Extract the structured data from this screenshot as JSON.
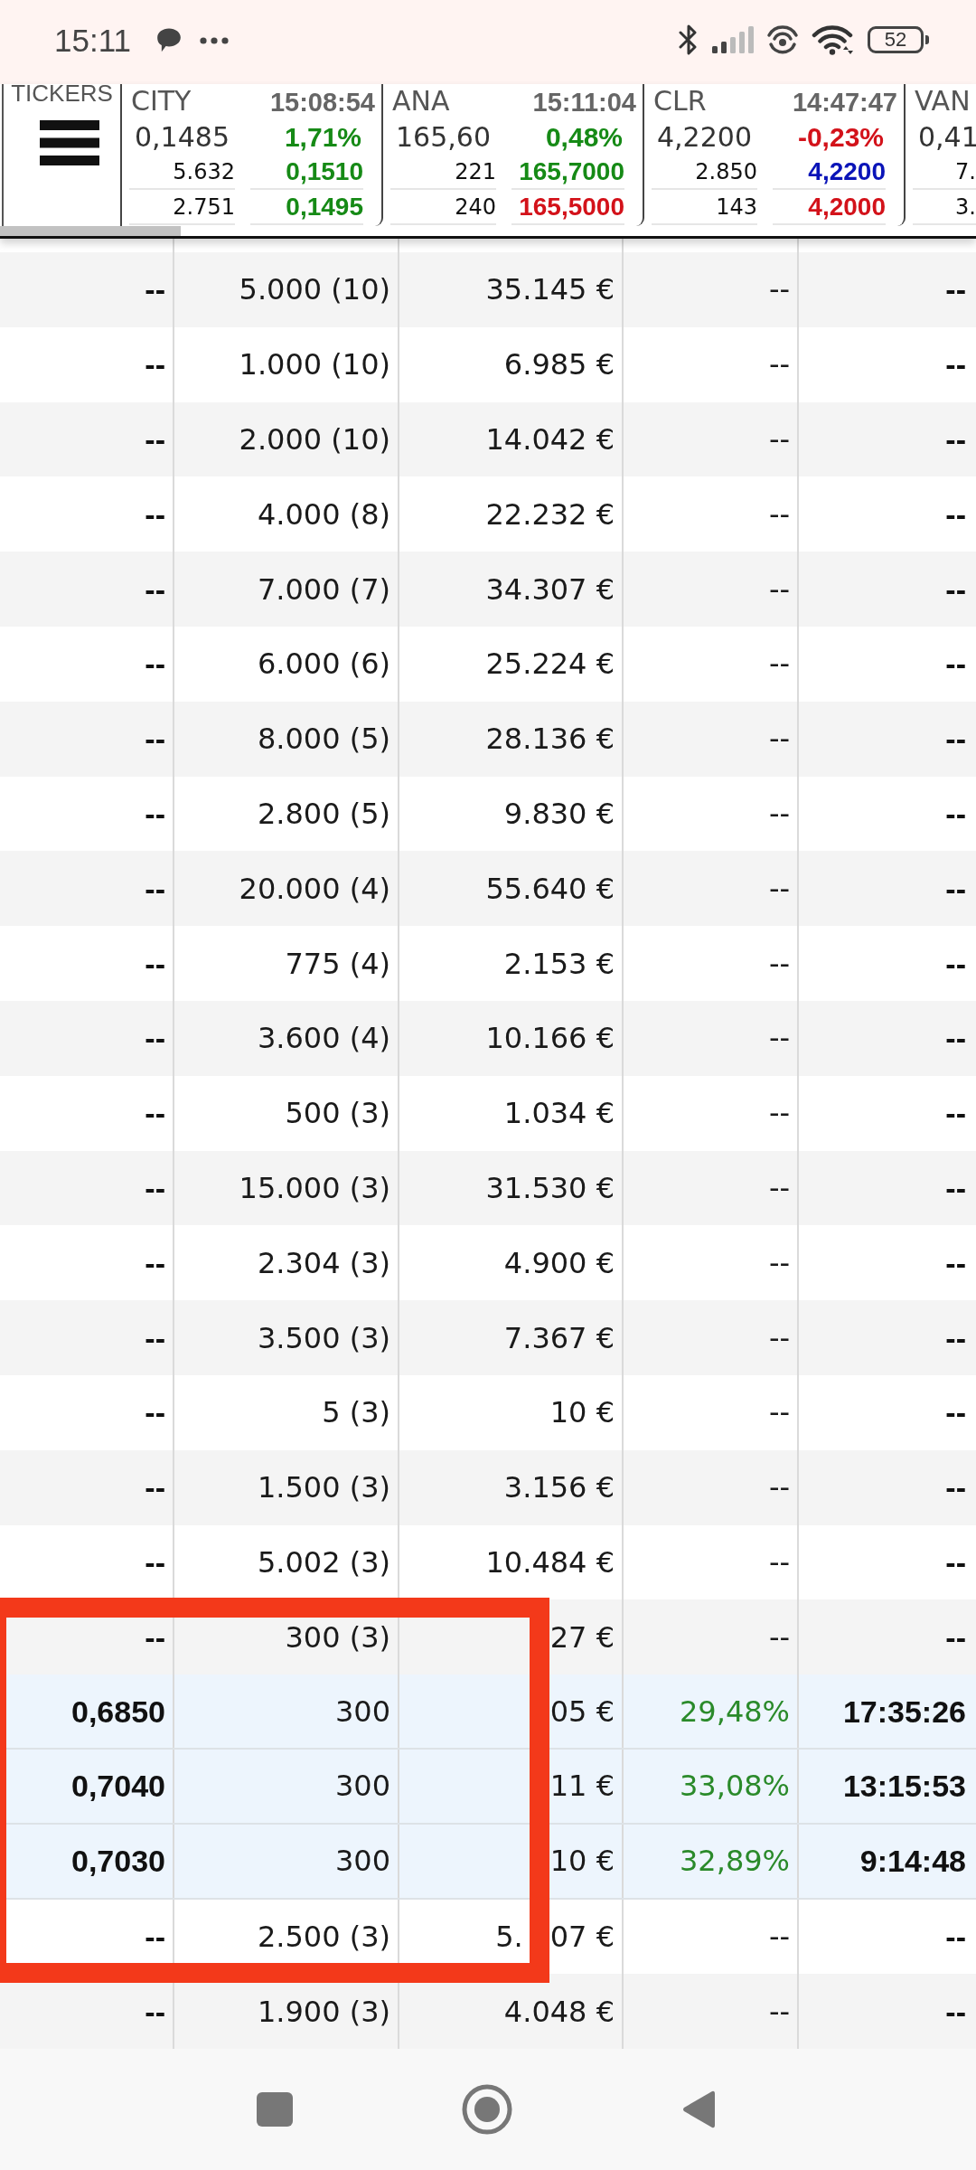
{
  "status_bar": {
    "time": "15:11",
    "battery": "52"
  },
  "tickers": {
    "label": "TICKERS",
    "items": [
      {
        "symbol": "CITY",
        "time": "15:08:54",
        "price": "0,1485",
        "change": {
          "text": "1,71%",
          "color": "#168a16"
        },
        "quotes": [
          {
            "volume": "5.632",
            "price": "0,1510",
            "color": "#168a16"
          },
          {
            "volume": "2.751",
            "price": "0,1495",
            "color": "#168a16"
          }
        ]
      },
      {
        "symbol": "ANA",
        "time": "15:11:04",
        "price": "165,60",
        "change": {
          "text": "0,48%",
          "color": "#168a16"
        },
        "quotes": [
          {
            "volume": "221",
            "price": "165,7000",
            "color": "#168a16"
          },
          {
            "volume": "240",
            "price": "165,5000",
            "color": "#d3121a"
          }
        ]
      },
      {
        "symbol": "CLR",
        "time": "14:47:47",
        "price": "4,2200",
        "change": {
          "text": "-0,23%",
          "color": "#d3121a"
        },
        "quotes": [
          {
            "volume": "2.850",
            "price": "4,2200",
            "color": "#0a14b8"
          },
          {
            "volume": "143",
            "price": "4,2000",
            "color": "#d3121a"
          }
        ]
      },
      {
        "symbol": "VAN",
        "price": "0,41",
        "quotes": [
          {
            "volume": "7."
          },
          {
            "volume": "3."
          }
        ]
      }
    ]
  },
  "table": {
    "rows": [
      {
        "cells": [
          "--",
          "5.000 (10)",
          "35.145 €",
          "--",
          "--"
        ]
      },
      {
        "cells": [
          "--",
          "1.000 (10)",
          "6.985 €",
          "--",
          "--"
        ]
      },
      {
        "cells": [
          "--",
          "2.000 (10)",
          "14.042 €",
          "--",
          "--"
        ]
      },
      {
        "cells": [
          "--",
          "4.000 (8)",
          "22.232 €",
          "--",
          "--"
        ]
      },
      {
        "cells": [
          "--",
          "7.000 (7)",
          "34.307 €",
          "--",
          "--"
        ]
      },
      {
        "cells": [
          "--",
          "6.000 (6)",
          "25.224 €",
          "--",
          "--"
        ]
      },
      {
        "cells": [
          "--",
          "8.000 (5)",
          "28.136 €",
          "--",
          "--"
        ]
      },
      {
        "cells": [
          "--",
          "2.800 (5)",
          "9.830 €",
          "--",
          "--"
        ]
      },
      {
        "cells": [
          "--",
          "20.000 (4)",
          "55.640 €",
          "--",
          "--"
        ]
      },
      {
        "cells": [
          "--",
          "775 (4)",
          "2.153 €",
          "--",
          "--"
        ]
      },
      {
        "cells": [
          "--",
          "3.600 (4)",
          "10.166 €",
          "--",
          "--"
        ]
      },
      {
        "cells": [
          "--",
          "500 (3)",
          "1.034 €",
          "--",
          "--"
        ]
      },
      {
        "cells": [
          "--",
          "15.000 (3)",
          "31.530 €",
          "--",
          "--"
        ]
      },
      {
        "cells": [
          "--",
          "2.304 (3)",
          "4.900 €",
          "--",
          "--"
        ]
      },
      {
        "cells": [
          "--",
          "3.500 (3)",
          "7.367 €",
          "--",
          "--"
        ]
      },
      {
        "cells": [
          "--",
          "5 (3)",
          "10 €",
          "--",
          "--"
        ]
      },
      {
        "cells": [
          "--",
          "1.500 (3)",
          "3.156 €",
          "--",
          "--"
        ]
      },
      {
        "cells": [
          "--",
          "5.002 (3)",
          "10.484 €",
          "--",
          "--"
        ]
      },
      {
        "cells": [
          "--",
          "300 (3)",
          "27 €",
          "--",
          "--"
        ],
        "children": [
          {
            "cells": [
              "0,6850",
              "300",
              "05 €",
              "29,48%",
              "17:35:26"
            ],
            "color": "#2a8a2a"
          },
          {
            "cells": [
              "0,7040",
              "300",
              "11 €",
              "33,08%",
              "13:15:53"
            ],
            "color": "#2a8a2a"
          },
          {
            "cells": [
              "0,7030",
              "300",
              "10 €",
              "32,89%",
              "9:14:48"
            ],
            "color": "#2a8a2a"
          }
        ]
      },
      {
        "cells": [
          "--",
          "2.500 (3)",
          [
            "5.",
            "07 €"
          ],
          "--",
          "--"
        ]
      },
      {
        "cells": [
          "--",
          "1.900 (3)",
          "4.048 €",
          "--",
          "--"
        ]
      }
    ]
  },
  "annotations": [
    {
      "kind": "frame"
    }
  ]
}
